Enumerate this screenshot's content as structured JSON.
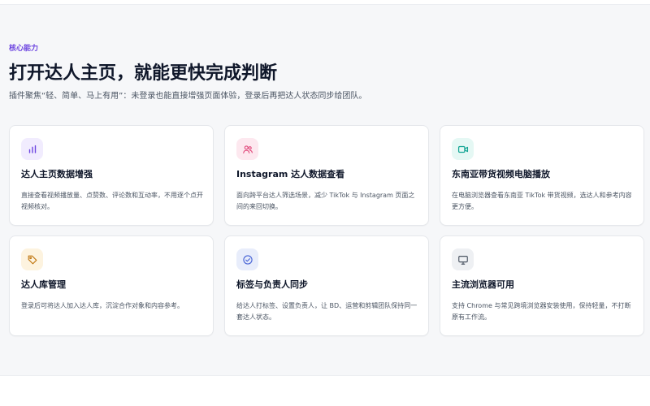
{
  "hero": {
    "eyebrow": "核心能力",
    "title": "打开达人主页，就能更快完成判断",
    "subtitle": "插件聚焦“轻、简单、马上有用”：未登录也能直接增强页面体验，登录后再把达人状态同步给团队。"
  },
  "colors": {
    "accent": "#6d45e0",
    "section_bg": "#f6f7f9",
    "card_bg": "#ffffff",
    "card_border": "#e5e7eb"
  },
  "cards": [
    {
      "title": "达人主页数据增强",
      "desc": "直接查看视频播放量、点赞数、评论数和互动率，不用逐个点开视频核对。",
      "icon": "bar-chart-icon",
      "icon_color": "#6d45e0",
      "icon_bg": "#f1ecfe"
    },
    {
      "title": "Instagram 达人数据查看",
      "desc": "面向跨平台达人筛选场景，减少 TikTok 与 Instagram 页面之间的来回切换。",
      "icon": "users-icon",
      "icon_color": "#e14b7d",
      "icon_bg": "#fde8ef"
    },
    {
      "title": "东南亚带货视频电脑播放",
      "desc": "在电脑浏览器查看东南亚 TikTok 带货视频，选达人和参考内容更方便。",
      "icon": "video-camera-icon",
      "icon_color": "#12a594",
      "icon_bg": "#e5f8f4"
    },
    {
      "title": "达人库管理",
      "desc": "登录后可将达人加入达人库，沉淀合作对象和内容参考。",
      "icon": "tag-icon",
      "icon_color": "#c27a16",
      "icon_bg": "#fdf3df"
    },
    {
      "title": "标签与负责人同步",
      "desc": "给达人打标签、设置负责人，让 BD、运营和剪辑团队保持同一套达人状态。",
      "icon": "check-circle-icon",
      "icon_color": "#4965d6",
      "icon_bg": "#e8edfb"
    },
    {
      "title": "主流浏览器可用",
      "desc": "支持 Chrome 与常见跨境浏览器安装使用，保持轻量，不打断原有工作流。",
      "icon": "monitor-icon",
      "icon_color": "#4b5563",
      "icon_bg": "#eef0f3"
    }
  ]
}
